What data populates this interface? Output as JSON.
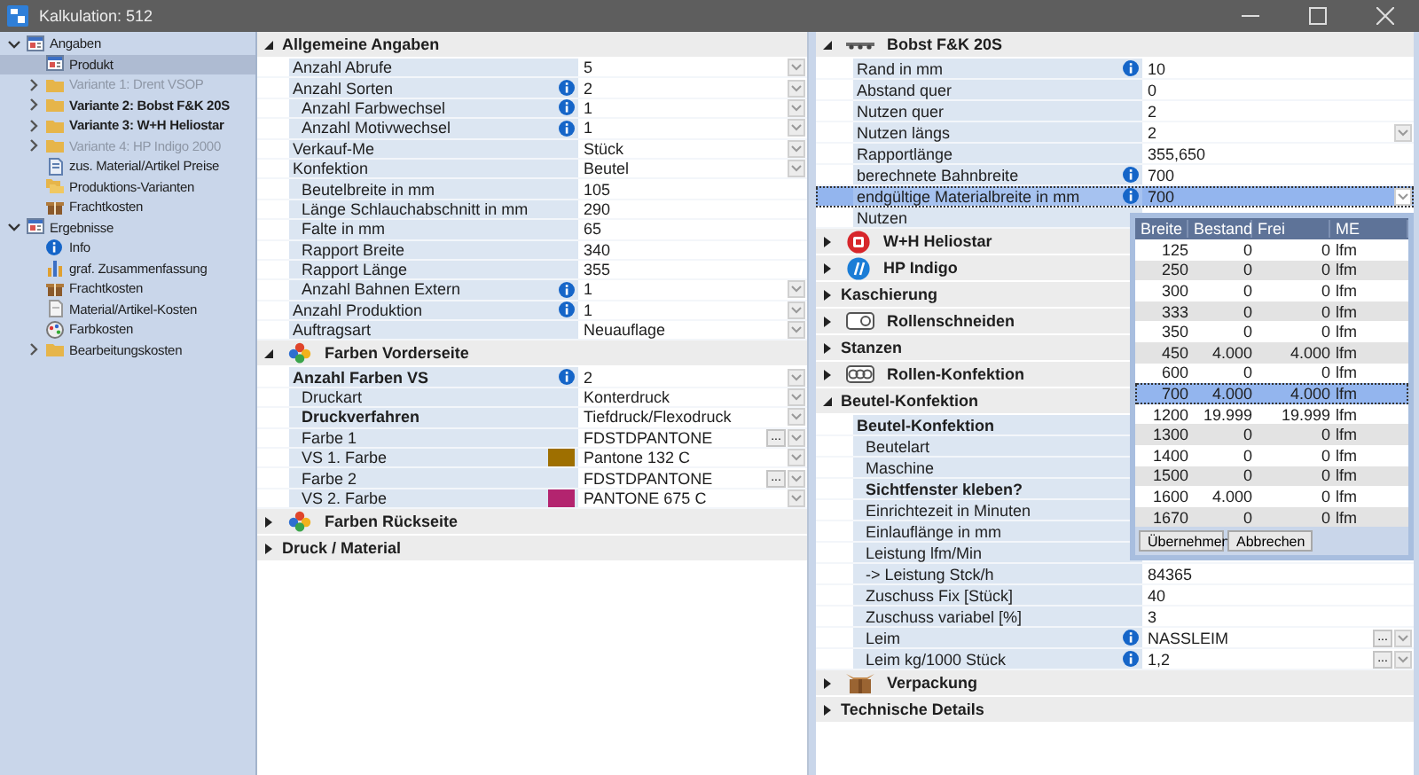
{
  "window": {
    "title": "Kalkulation: 512"
  },
  "sidebar": {
    "items": [
      {
        "label": "Angaben",
        "kind": "form",
        "selected": false,
        "disabled": false,
        "expanded": true,
        "children": [
          {
            "label": "Produkt",
            "kind": "form",
            "selected": true,
            "disabled": false
          },
          {
            "label": "Variante 1: Drent VSOP",
            "kind": "folder",
            "selected": false,
            "disabled": true,
            "expanded": false
          },
          {
            "label": "Variante 2: Bobst F&K 20S",
            "kind": "folder",
            "selected": false,
            "disabled": false,
            "bold": true,
            "expanded": false
          },
          {
            "label": "Variante 3: W+H Heliostar",
            "kind": "folder",
            "selected": false,
            "disabled": false,
            "bold": true,
            "expanded": false
          },
          {
            "label": "Variante 4: HP Indigo 2000",
            "kind": "folder",
            "selected": false,
            "disabled": true,
            "expanded": false
          },
          {
            "label": "zus. Material/Artikel Preise",
            "kind": "document",
            "selected": false,
            "disabled": false
          },
          {
            "label": "Produktions-Varianten",
            "kind": "folders",
            "selected": false,
            "disabled": false
          },
          {
            "label": "Frachtkosten",
            "kind": "package",
            "selected": false,
            "disabled": false
          }
        ]
      },
      {
        "label": "Ergebnisse",
        "kind": "form",
        "selected": false,
        "disabled": false,
        "expanded": true,
        "children": [
          {
            "label": "Info",
            "kind": "info",
            "selected": false,
            "disabled": false
          },
          {
            "label": "graf. Zusammenfassung",
            "kind": "chart",
            "selected": false,
            "disabled": false
          },
          {
            "label": "Frachtkosten",
            "kind": "package",
            "selected": false,
            "disabled": false
          },
          {
            "label": "Material/Artikel-Kosten",
            "kind": "page",
            "selected": false,
            "disabled": false
          },
          {
            "label": "Farbkosten",
            "kind": "palette",
            "selected": false,
            "disabled": false
          },
          {
            "label": "Bearbeitungskosten",
            "kind": "folder",
            "selected": false,
            "disabled": false,
            "expanded": false
          }
        ]
      }
    ]
  },
  "middle_panel": {
    "sections": [
      {
        "title": "Allgemeine Angaben",
        "expanded": true,
        "rows": [
          {
            "label": "Anzahl Abrufe",
            "value": "5",
            "dropdown": true,
            "selected": false
          },
          {
            "label": "Anzahl Sorten",
            "value": "2",
            "info": true,
            "dropdown": true,
            "selected": false,
            "children": [
              {
                "label": "Anzahl Farbwechsel",
                "value": "1",
                "info": true,
                "dropdown": true,
                "selected": false
              },
              {
                "label": "Anzahl Motivwechsel",
                "value": "1",
                "info": true,
                "dropdown": true,
                "selected": false
              }
            ]
          },
          {
            "label": "Verkauf-Me",
            "value": "Stück",
            "dropdown": true,
            "selected": false
          },
          {
            "label": "Konfektion",
            "value": "Beutel",
            "dropdown": true,
            "selected": false,
            "children": [
              {
                "label": "Beutelbreite in mm",
                "value": "105",
                "selected": false
              },
              {
                "label": "Länge Schlauchabschnitt in mm",
                "value": "290",
                "selected": false
              },
              {
                "label": "Falte in mm",
                "value": "65",
                "selected": false
              },
              {
                "label": "Rapport Breite",
                "value": "340",
                "selected": false
              },
              {
                "label": "Rapport Länge",
                "value": "355",
                "selected": false
              },
              {
                "label": "Anzahl Bahnen Extern",
                "value": "1",
                "info": true,
                "dropdown": true,
                "selected": false
              }
            ]
          },
          {
            "label": "Anzahl Produktion",
            "value": "1",
            "info": true,
            "dropdown": true,
            "selected": false
          },
          {
            "label": "Auftragsart",
            "value": "Neuauflage",
            "dropdown": true,
            "selected": false
          }
        ]
      },
      {
        "title": "Farben Vorderseite",
        "expanded": true,
        "kind": "colors",
        "rows": [
          {
            "label": "Anzahl Farben VS",
            "value": "2",
            "bold": true,
            "info": true,
            "dropdown": true,
            "selected": false,
            "children": [
              {
                "label": "Druckart",
                "value": "Konterdruck",
                "dropdown": true,
                "selected": false
              },
              {
                "label": "Druckverfahren",
                "value": "Tiefdruck/Flexodruck",
                "bold": true,
                "dropdown": true,
                "selected": false
              },
              {
                "label": "Farbe 1",
                "value": "FDSTDPANTONE",
                "more": "...",
                "dropdown": true,
                "selected": false
              },
              {
                "label": "VS 1. Farbe",
                "value": "Pantone 132 C",
                "color": "#9e6f00",
                "dropdown": true,
                "selected": false
              },
              {
                "label": "Farbe 2",
                "value": "FDSTDPANTONE",
                "more": "...",
                "dropdown": true,
                "selected": false
              },
              {
                "label": "VS 2. Farbe",
                "value": "PANTONE 675 C",
                "color": "#b3246f",
                "dropdown": true,
                "selected": false
              }
            ]
          }
        ]
      },
      {
        "title": "Farben Rückseite",
        "expanded": false,
        "kind": "colors"
      },
      {
        "title": "Druck / Material",
        "expanded": false
      }
    ]
  },
  "right_panel": {
    "sections": [
      {
        "title": "Bobst F&K 20S",
        "expanded": true,
        "kind": "machine",
        "rows": [
          {
            "label": "Rand in mm",
            "value": "10",
            "info": true,
            "selected": false
          },
          {
            "label": "Abstand quer",
            "value": "0",
            "selected": false
          },
          {
            "label": "Nutzen quer",
            "value": "2",
            "selected": false
          },
          {
            "label": "Nutzen längs",
            "value": "2",
            "dropdown": true,
            "selected": false
          },
          {
            "label": "Rapportlänge",
            "value": "355,650",
            "selected": false
          },
          {
            "label": "berechnete Bahnbreite",
            "value": "700",
            "info": true,
            "selected": false
          },
          {
            "label": "endgültige Materialbreite in mm",
            "value": "700",
            "info": true,
            "dropdown": true,
            "selected": true
          },
          {
            "label": "Nutzen",
            "selected": false
          }
        ]
      },
      {
        "title": "W+H Heliostar",
        "expanded": false,
        "kind": "emblem"
      },
      {
        "title": "HP Indigo",
        "expanded": false,
        "kind": "logo"
      },
      {
        "title": "Kaschierung",
        "expanded": false
      },
      {
        "title": "Rollenschneiden",
        "expanded": false,
        "kind": "roll"
      },
      {
        "title": "Stanzen",
        "expanded": false
      },
      {
        "title": "Rollen-Konfektion",
        "expanded": false,
        "kind": "rolls"
      },
      {
        "title": "Beutel-Konfektion",
        "expanded": true,
        "rows": [
          {
            "label": "Beutel-Konfektion",
            "bold": true,
            "selected": false,
            "children": [
              {
                "label": "Beutelart",
                "selected": false
              },
              {
                "label": "Maschine",
                "selected": false
              },
              {
                "label": "Sichtfenster kleben?",
                "bold": true,
                "selected": false
              },
              {
                "label": "Einrichtezeit in Minuten",
                "selected": false
              },
              {
                "label": "Einlauflänge in mm",
                "selected": false
              },
              {
                "label": "Leistung lfm/Min",
                "selected": false
              },
              {
                "label": "-> Leistung Stck/h",
                "value": "84365",
                "selected": false
              },
              {
                "label": "Zuschuss Fix [Stück]",
                "value": "40",
                "selected": false
              },
              {
                "label": "Zuschuss variabel [%]",
                "value": "3",
                "selected": false
              },
              {
                "label": "Leim",
                "value": "NASSLEIM",
                "info": true,
                "more": "...",
                "dropdown": true,
                "selected": false
              },
              {
                "label": "Leim kg/1000 Stück",
                "value": "1,2",
                "info": true,
                "more": "...",
                "dropdown": true,
                "selected": false
              }
            ]
          }
        ]
      },
      {
        "title": "Verpackung",
        "expanded": false,
        "kind": "box"
      },
      {
        "title": "Technische Details",
        "expanded": false
      }
    ],
    "popup": {
      "columns": [
        "Breite",
        "Bestand",
        "Frei",
        "ME"
      ],
      "rows": [
        {
          "cells": [
            "125",
            "0",
            "0",
            "lfm"
          ],
          "selected": false
        },
        {
          "cells": [
            "250",
            "0",
            "0",
            "lfm"
          ],
          "selected": false
        },
        {
          "cells": [
            "300",
            "0",
            "0",
            "lfm"
          ],
          "selected": false
        },
        {
          "cells": [
            "333",
            "0",
            "0",
            "lfm"
          ],
          "selected": false
        },
        {
          "cells": [
            "350",
            "0",
            "0",
            "lfm"
          ],
          "selected": false
        },
        {
          "cells": [
            "450",
            "4.000",
            "4.000",
            "lfm"
          ],
          "selected": false
        },
        {
          "cells": [
            "600",
            "0",
            "0",
            "lfm"
          ],
          "selected": false
        },
        {
          "cells": [
            "700",
            "4.000",
            "4.000",
            "lfm"
          ],
          "selected": true
        },
        {
          "cells": [
            "1200",
            "19.999",
            "19.999",
            "lfm"
          ],
          "selected": false
        },
        {
          "cells": [
            "1300",
            "0",
            "0",
            "lfm"
          ],
          "selected": false
        },
        {
          "cells": [
            "1400",
            "0",
            "0",
            "lfm"
          ],
          "selected": false
        },
        {
          "cells": [
            "1500",
            "0",
            "0",
            "lfm"
          ],
          "selected": false
        },
        {
          "cells": [
            "1600",
            "4.000",
            "0",
            "lfm"
          ],
          "selected": false
        },
        {
          "cells": [
            "1670",
            "0",
            "0",
            "lfm"
          ],
          "selected": false
        }
      ],
      "buttons": [
        "Übernehmen",
        "Abbrechen"
      ]
    }
  }
}
